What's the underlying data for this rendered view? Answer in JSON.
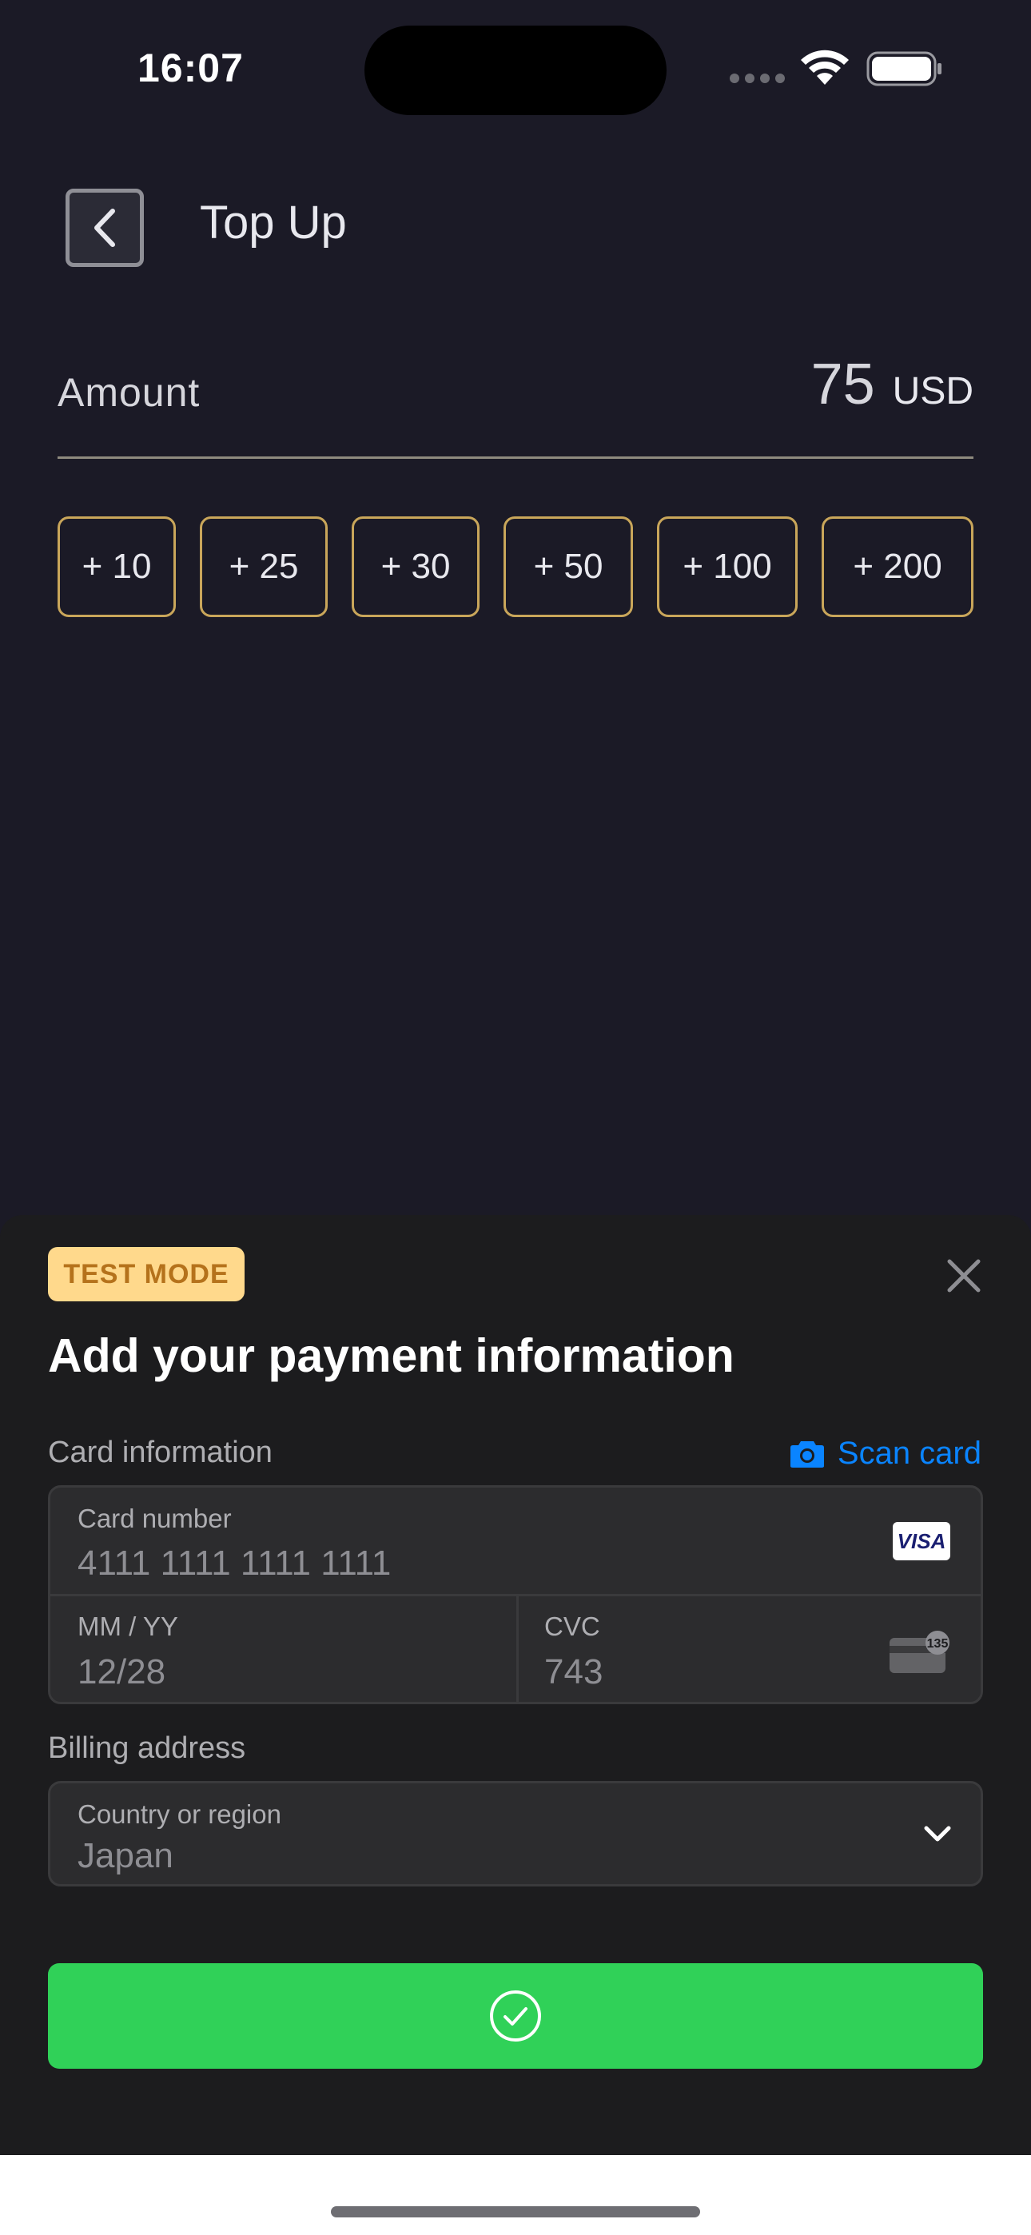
{
  "status_bar": {
    "time": "16:07"
  },
  "header": {
    "title": "Top Up"
  },
  "amount": {
    "label": "Amount",
    "value": "75",
    "unit": "USD"
  },
  "quick_amounts": [
    "+ 10",
    "+ 25",
    "+ 30",
    "+ 50",
    "+ 100",
    "+ 200"
  ],
  "payment_sheet": {
    "badge": "TEST MODE",
    "title": "Add your payment information",
    "card_section_label": "Card information",
    "scan_card_label": "Scan card",
    "card_number": {
      "label": "Card number",
      "value": "4111 1111 1111 1111"
    },
    "expiry": {
      "label": "MM / YY",
      "value": "12/28"
    },
    "cvc": {
      "label": "CVC",
      "value": "743"
    },
    "card_brand": "VISA",
    "cvc_icon_text": "135",
    "billing_section_label": "Billing address",
    "country": {
      "label": "Country or region",
      "value": "Japan"
    },
    "accent_color": "#0a84ff",
    "confirm_color": "#30d158",
    "badge_color": "#ffd98c"
  },
  "colors": {
    "background": "#1b1a26",
    "chip_border": "#c9a65a",
    "sheet": "#1c1c1e"
  }
}
